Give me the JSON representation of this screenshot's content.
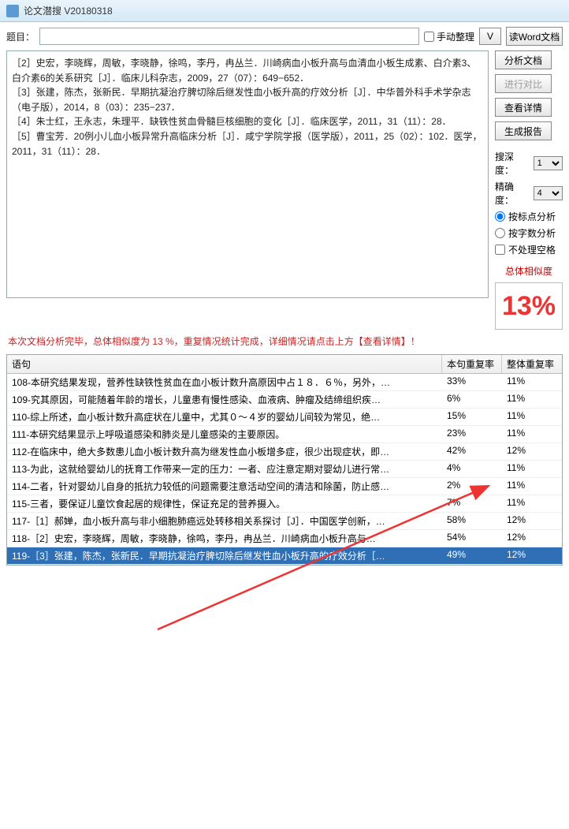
{
  "window": {
    "title": "论文潜搜 V20180318"
  },
  "top": {
    "subject_label": "题目：",
    "subject_value": "",
    "manual_sort": "手动整理",
    "v_btn": "V",
    "read_word": "读Word文档"
  },
  "text_lines": [
    "［2］史宏，李晓辉，周敏，李晓静，徐鸣，李丹，冉丛兰．川崎病血小板升高与血清血小板生成素、白介素3、白介素6的关系研究［J］．临床儿科杂志，2009，27（07）：649−652．",
    "［3］张建，陈杰，张新民．早期抗凝治疗脾切除后继发性血小板升高的疗效分析［J］．中华普外科手术学杂志（电子版），2014，8（03）：235−237．",
    "［4］朱士红，王永志，朱理平．缺铁性贫血骨髓巨核细胞的变化［J］．临床医学，2011，31（11）：28．",
    "［5］曹宝芳．20例小儿血小板异常升高临床分析［J］．咸宁学院学报（医学版），2011，25（02）：102．医学，2011，31（11）：28．"
  ],
  "side": {
    "analyze": "分析文档",
    "compare": "进行对比",
    "details": "查看详情",
    "report": "生成报告",
    "depth_lbl": "搜深度：",
    "depth_val": "1",
    "precision_lbl": "精确度：",
    "precision_val": "4",
    "by_punct": "按标点分析",
    "by_count": "按字数分析",
    "no_space": "不处理空格",
    "sim_label": "总体相似度",
    "sim_value": "13%"
  },
  "status": "本次文档分析完毕，总体相似度为 13 %，重复情况统计完成，详细情况请点击上方【查看详情】！",
  "table": {
    "col1": "语句",
    "col2": "本句重复率",
    "col3": "整体重复率",
    "rows": [
      {
        "s": "108-本研究结果发现，营养性缺铁性贫血在血小板计数升高原因中占１８．６％，另外，…",
        "r1": "33%",
        "r2": "11%"
      },
      {
        "s": "109-究其原因，可能随着年龄的增长，儿童患有慢性感染、血液病、肿瘤及结缔组织疾…",
        "r1": "6%",
        "r2": "11%"
      },
      {
        "s": "110-综上所述，血小板计数升高症状在儿童中，尤其０～４岁的婴幼儿间较为常见，绝…",
        "r1": "15%",
        "r2": "11%"
      },
      {
        "s": "111-本研究结果显示上呼吸道感染和肺炎是儿童感染的主要原因。",
        "r1": "23%",
        "r2": "11%"
      },
      {
        "s": "112-在临床中，绝大多数患儿血小板计数升高为继发性血小板增多症，很少出现症状，即…",
        "r1": "42%",
        "r2": "12%"
      },
      {
        "s": "113-为此，这就给婴幼儿的抚育工作带来一定的压力：一者、应注意定期对婴幼儿进行常…",
        "r1": "4%",
        "r2": "11%"
      },
      {
        "s": "114-二者，针对婴幼儿自身的抵抗力较低的问题需要注意活动空间的清洁和除菌，防止感…",
        "r1": "2%",
        "r2": "11%"
      },
      {
        "s": "115-三者，要保证儿童饮食起居的规律性，保证充足的营养摄入。",
        "r1": "7%",
        "r2": "11%"
      },
      {
        "s": "117-［1］郝婵，血小板升高与非小细胞肺癌远处转移相关系探讨［J］．中国医学创新，…",
        "r1": "58%",
        "r2": "12%"
      },
      {
        "s": "118-［2］史宏，李晓辉，周敏，李晓静，徐鸣，李丹，冉丛兰．川崎病血小板升高与…",
        "r1": "54%",
        "r2": "12%"
      },
      {
        "s": "119-［3］张建，陈杰，张新民．早期抗凝治疗脾切除后继发性血小板升高的疗效分析［…",
        "r1": "49%",
        "r2": "12%",
        "sel": true
      }
    ]
  }
}
